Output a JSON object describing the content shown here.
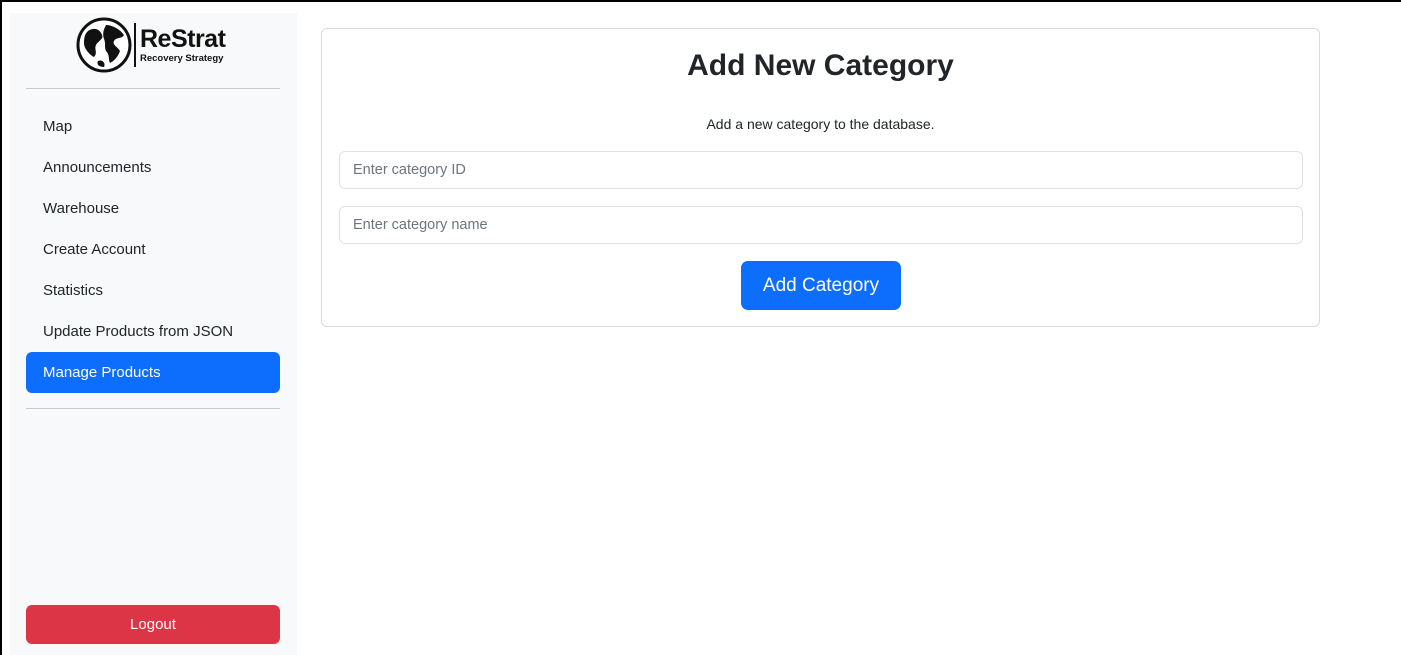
{
  "brand": {
    "name": "ReStrat",
    "tagline": "Recovery Strategy"
  },
  "sidebar": {
    "items": [
      {
        "label": "Map",
        "active": false
      },
      {
        "label": "Announcements",
        "active": false
      },
      {
        "label": "Warehouse",
        "active": false
      },
      {
        "label": "Create Account",
        "active": false
      },
      {
        "label": "Statistics",
        "active": false
      },
      {
        "label": "Update Products from JSON",
        "active": false
      },
      {
        "label": "Manage Products",
        "active": true
      }
    ],
    "logout_label": "Logout"
  },
  "form": {
    "title": "Add New Category",
    "description": "Add a new category to the database.",
    "category_id": {
      "value": "",
      "placeholder": "Enter category ID"
    },
    "category_name": {
      "value": "",
      "placeholder": "Enter category name"
    },
    "submit_label": "Add Category"
  },
  "colors": {
    "primary": "#0d6efd",
    "danger": "#dc3545",
    "sidebar_bg": "#f8f9fa"
  }
}
